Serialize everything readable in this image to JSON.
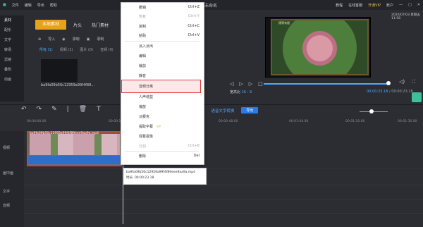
{
  "titlebar": {
    "menus": [
      "文件",
      "编辑",
      "导出",
      "帮助"
    ],
    "doc_title": "未命名",
    "right": [
      "教程",
      "在线客服",
      "开通VIP",
      "账户"
    ]
  },
  "preview": {
    "timestamp": "2020/07/03 星期五 11:58",
    "watermark": "建锦有限"
  },
  "sidebar": {
    "items": [
      "素材",
      "配乐",
      "文字",
      "转场",
      "滤镜",
      "叠附",
      "动画"
    ]
  },
  "tabs": [
    "本地素材",
    "片头",
    "热门素材"
  ],
  "toolrow": [
    "导入",
    "录制",
    "录制"
  ],
  "filters": [
    "所有 (1)",
    "视频 (1)",
    "图片 (0)",
    "音频 (0)"
  ],
  "thumb": {
    "name": "ba9fa09b56c12959a99f4f88..."
  },
  "player": {
    "ratio_label": "宽高比",
    "ratio_value": "16 : 9",
    "current": "00:00:23.18",
    "total": "/ 00:00:23.18"
  },
  "toolbar": {
    "speech": "语音文字转换",
    "export": "导出"
  },
  "ruler": [
    "00:00:00.00",
    "00:00:16.00",
    "00:00:48.00",
    "00:01:04.00",
    "00:01:20.00",
    "00:01:36.00"
  ],
  "tracks": [
    "视频",
    "画中画",
    "文字",
    "音频"
  ],
  "clip": {
    "name": "ba9fa09b56c12959a99f4f89eee9aa9a.mp4",
    "tooltip_name": "ba9fa09b56c12959a99f4f89eee9aa9a.mp4",
    "tooltip_duration": "时长: 00:00:23.18"
  },
  "context_menu": {
    "items": [
      {
        "label": "撤销",
        "shortcut": "Ctrl+Z",
        "disabled": false
      },
      {
        "label": "恢复",
        "shortcut": "Ctrl+Y",
        "disabled": true
      },
      {
        "label": "复制",
        "shortcut": "Ctrl+C",
        "disabled": false
      },
      {
        "label": "粘贴",
        "shortcut": "Ctrl+V",
        "disabled": false
      },
      {
        "label": "淡入淡出",
        "shortcut": "",
        "disabled": false
      },
      {
        "label": "编辑",
        "shortcut": "",
        "disabled": false
      },
      {
        "label": "裁剪",
        "shortcut": "",
        "disabled": false
      },
      {
        "label": "静音",
        "shortcut": "",
        "disabled": false
      },
      {
        "label": "音频分离",
        "shortcut": "",
        "disabled": false
      },
      {
        "label": "人声增益",
        "shortcut": "",
        "disabled": false
      },
      {
        "label": "缩放",
        "shortcut": "",
        "disabled": false
      },
      {
        "label": "马赛克",
        "shortcut": "",
        "disabled": false
      },
      {
        "label": "提取字幕",
        "shortcut": "",
        "disabled": false
      },
      {
        "label": "绿幕抠像",
        "shortcut": "",
        "disabled": false
      },
      {
        "label": "分割",
        "shortcut": "Ctrl+B",
        "disabled": true
      },
      {
        "label": "删除",
        "shortcut": "Del",
        "disabled": false
      }
    ],
    "vip_badge": "VIP"
  }
}
